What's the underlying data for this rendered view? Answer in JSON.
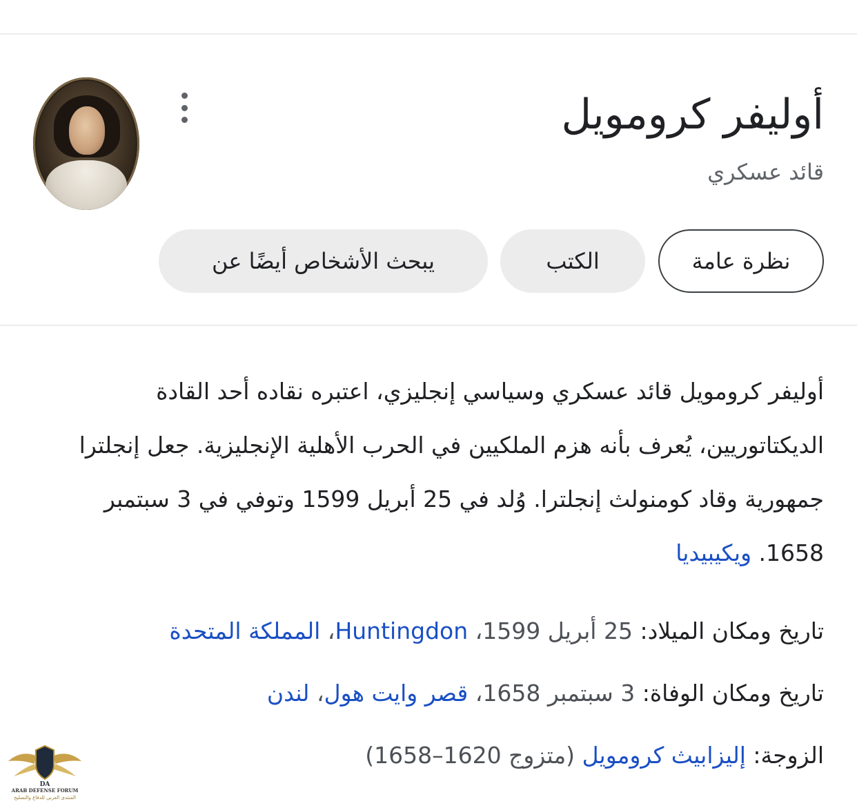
{
  "knowledge_panel": {
    "title": "أوليفر كرومويل",
    "subtitle": "قائد عسكري",
    "more_menu_icon": "more-vert-icon",
    "portrait_alt": "portrait"
  },
  "chips": {
    "overview": "نظرة عامة",
    "books": "الكتب",
    "people_also_search": "يبحث الأشخاص أيضًا عن"
  },
  "description": {
    "text": "أوليفر كرومويل  قائد عسكري وسياسي إنجليزي، اعتبره نقاده أحد القادة الديكتاتوريين، يُعرف بأنه هزم الملكيين في الحرب الأهلية الإنجليزية. جعل إنجلترا جمهورية وقاد كومنولث إنجلترا. وُلد في 25 أبريل 1599 وتوفي في 3 سبتمبر 1658.",
    "source_link": "ويكيبيديا"
  },
  "facts": {
    "birth": {
      "label": "تاريخ ومكان الميلاد:",
      "date": "25 أبريل 1599",
      "separator": "، ",
      "place_link": "Huntingdon",
      "place_sep": "، ",
      "country_link": "المملكة المتحدة"
    },
    "death": {
      "label": "تاريخ ومكان الوفاة:",
      "date": "3 سبتمبر 1658",
      "separator": "، ",
      "place_link": "قصر وايت هول",
      "place_sep": "، ",
      "city_link": "لندن"
    },
    "spouse": {
      "label": "الزوجة:",
      "name_link": "إليزابيث كرومويل",
      "years": "(متزوج 1620–1658)"
    }
  },
  "watermark": {
    "line1": "ARAB DEFENSE FORUM",
    "line2": "المنتدى العربي للدفاع والتسليح",
    "monogram": "DA"
  },
  "colors": {
    "link": "#1a4fc4",
    "chip_bg": "#ececed",
    "divider": "#ececec",
    "secondary_text": "#5f6368"
  }
}
